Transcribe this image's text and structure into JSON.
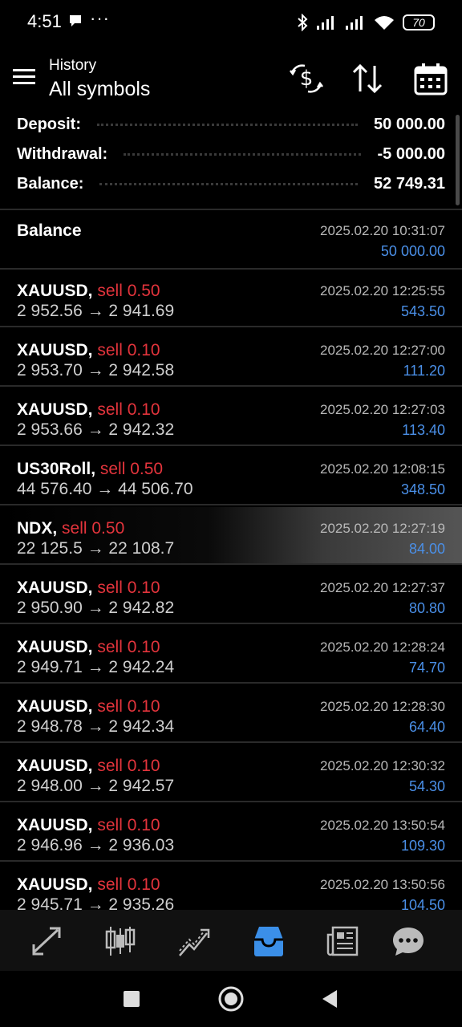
{
  "status": {
    "time": "4:51",
    "dots": "···",
    "battery": "70"
  },
  "header": {
    "title": "History",
    "subtitle": "All symbols"
  },
  "summary": [
    {
      "label": "Deposit:",
      "value": "50 000.00"
    },
    {
      "label": "Withdrawal:",
      "value": "-5 000.00"
    },
    {
      "label": "Balance:",
      "value": "52 749.31"
    }
  ],
  "balance_entry": {
    "label": "Balance",
    "date": "2025.02.20 10:31:07",
    "amount": "50 000.00"
  },
  "trades": [
    {
      "symbol": "XAUUSD,",
      "side": "sell 0.50",
      "prices": "2 952.56 → 2 941.69",
      "date": "2025.02.20 12:25:55",
      "profit": "543.50"
    },
    {
      "symbol": "XAUUSD,",
      "side": "sell 0.10",
      "prices": "2 953.70 → 2 942.58",
      "date": "2025.02.20 12:27:00",
      "profit": "111.20"
    },
    {
      "symbol": "XAUUSD,",
      "side": "sell 0.10",
      "prices": "2 953.66 → 2 942.32",
      "date": "2025.02.20 12:27:03",
      "profit": "113.40"
    },
    {
      "symbol": "US30Roll,",
      "side": "sell 0.50",
      "prices": "44 576.40 → 44 506.70",
      "date": "2025.02.20 12:08:15",
      "profit": "348.50"
    },
    {
      "symbol": "NDX,",
      "side": "sell 0.50",
      "prices": "22 125.5 → 22 108.7",
      "date": "2025.02.20 12:27:19",
      "profit": "84.00"
    },
    {
      "symbol": "XAUUSD,",
      "side": "sell 0.10",
      "prices": "2 950.90 → 2 942.82",
      "date": "2025.02.20 12:27:37",
      "profit": "80.80"
    },
    {
      "symbol": "XAUUSD,",
      "side": "sell 0.10",
      "prices": "2 949.71 → 2 942.24",
      "date": "2025.02.20 12:28:24",
      "profit": "74.70"
    },
    {
      "symbol": "XAUUSD,",
      "side": "sell 0.10",
      "prices": "2 948.78 → 2 942.34",
      "date": "2025.02.20 12:28:30",
      "profit": "64.40"
    },
    {
      "symbol": "XAUUSD,",
      "side": "sell 0.10",
      "prices": "2 948.00 → 2 942.57",
      "date": "2025.02.20 12:30:32",
      "profit": "54.30"
    },
    {
      "symbol": "XAUUSD,",
      "side": "sell 0.10",
      "prices": "2 946.96 → 2 936.03",
      "date": "2025.02.20 13:50:54",
      "profit": "109.30"
    },
    {
      "symbol": "XAUUSD,",
      "side": "sell 0.10",
      "prices": "2 945.71 → 2 935.26",
      "date": "2025.02.20 13:50:56",
      "profit": "104.50"
    }
  ],
  "colors": {
    "sell": "#e3343c",
    "profit": "#4a8fe7",
    "active_nav": "#3b8fe8"
  },
  "icons": {
    "top": [
      "currency-exchange-icon",
      "sort-icon",
      "calendar-icon"
    ],
    "bottom_nav": [
      "quotes-icon",
      "chart-icon",
      "trade-icon",
      "history-icon",
      "news-icon",
      "messages-icon"
    ],
    "active_nav": "history-icon"
  }
}
